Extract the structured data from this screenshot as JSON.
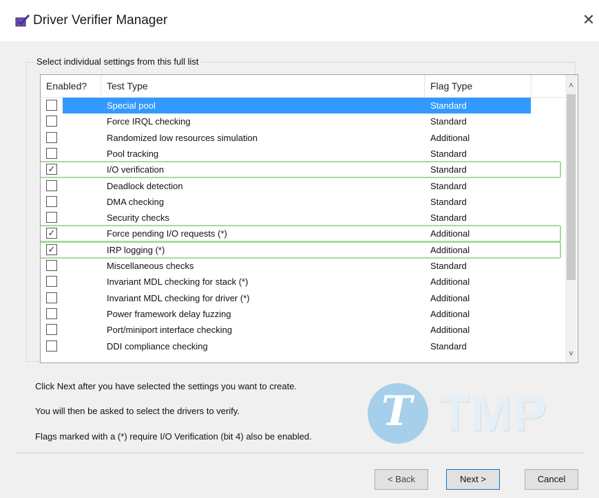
{
  "window": {
    "title": "Driver Verifier Manager",
    "close_label": "✕"
  },
  "group": {
    "legend": "Select individual settings from this full list"
  },
  "list": {
    "columns": [
      "Enabled?",
      "Test Type",
      "Flag Type"
    ],
    "rows": [
      {
        "checked": false,
        "name": "Special pool",
        "flag": "Standard",
        "selected": true,
        "highlight": false
      },
      {
        "checked": false,
        "name": "Force IRQL checking",
        "flag": "Standard",
        "selected": false,
        "highlight": false
      },
      {
        "checked": false,
        "name": "Randomized low resources simulation",
        "flag": "Additional",
        "selected": false,
        "highlight": false
      },
      {
        "checked": false,
        "name": "Pool tracking",
        "flag": "Standard",
        "selected": false,
        "highlight": false
      },
      {
        "checked": true,
        "name": "I/O verification",
        "flag": "Standard",
        "selected": false,
        "highlight": true
      },
      {
        "checked": false,
        "name": "Deadlock detection",
        "flag": "Standard",
        "selected": false,
        "highlight": false
      },
      {
        "checked": false,
        "name": "DMA checking",
        "flag": "Standard",
        "selected": false,
        "highlight": false
      },
      {
        "checked": false,
        "name": "Security checks",
        "flag": "Standard",
        "selected": false,
        "highlight": false
      },
      {
        "checked": true,
        "name": "Force pending I/O requests (*)",
        "flag": "Additional",
        "selected": false,
        "highlight": true
      },
      {
        "checked": true,
        "name": "IRP logging (*)",
        "flag": "Additional",
        "selected": false,
        "highlight": true
      },
      {
        "checked": false,
        "name": "Miscellaneous checks",
        "flag": "Standard",
        "selected": false,
        "highlight": false
      },
      {
        "checked": false,
        "name": "Invariant MDL checking for stack (*)",
        "flag": "Additional",
        "selected": false,
        "highlight": false
      },
      {
        "checked": false,
        "name": "Invariant MDL checking for driver (*)",
        "flag": "Additional",
        "selected": false,
        "highlight": false
      },
      {
        "checked": false,
        "name": "Power framework delay fuzzing",
        "flag": "Additional",
        "selected": false,
        "highlight": false
      },
      {
        "checked": false,
        "name": "Port/miniport interface checking",
        "flag": "Additional",
        "selected": false,
        "highlight": false
      },
      {
        "checked": false,
        "name": "DDI compliance checking",
        "flag": "Standard",
        "selected": false,
        "highlight": false
      }
    ],
    "check_glyph": "✓",
    "scroll_up_glyph": "˄",
    "scroll_down_glyph": "˅"
  },
  "info": {
    "line1": "Click Next after you have selected the settings you want to create.",
    "line2": "You will then be asked to select the drivers to verify.",
    "line3": "Flags marked with a (*) require I/O Verification (bit 4) also be enabled."
  },
  "watermark": {
    "letter": "T",
    "text": "TMP"
  },
  "buttons": {
    "back": "< Back",
    "next": "Next >",
    "cancel": "Cancel"
  },
  "colors": {
    "selection": "#3399ff",
    "highlight_border": "#a8d8a0"
  }
}
